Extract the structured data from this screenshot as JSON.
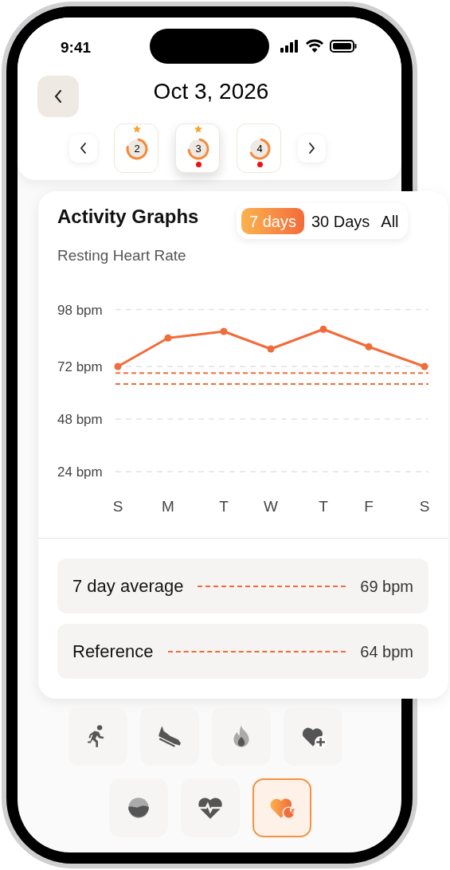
{
  "status_bar": {
    "time": "9:41"
  },
  "header": {
    "title": "Oct 3, 2026"
  },
  "days": [
    {
      "label": "2",
      "starred": true,
      "alert": false,
      "selected": false
    },
    {
      "label": "3",
      "starred": true,
      "alert": true,
      "selected": true
    },
    {
      "label": "4",
      "starred": false,
      "alert": true,
      "selected": false
    }
  ],
  "card": {
    "title": "Activity Graphs",
    "ranges": [
      {
        "label": "7 days",
        "selected": true
      },
      {
        "label": "30 Days",
        "selected": false
      },
      {
        "label": "All",
        "selected": false
      }
    ],
    "subtitle": "Resting Heart Rate",
    "chart_data": {
      "type": "line",
      "categories": [
        "S",
        "M",
        "T",
        "W",
        "T",
        "F",
        "S"
      ],
      "series": [
        {
          "color": "#f26b3a",
          "marker": "o",
          "values": [
            72,
            85,
            88,
            80,
            89,
            81,
            72
          ]
        }
      ],
      "ylim": [
        24,
        98
      ],
      "yticks": [
        {
          "value": 24,
          "label": "24 bpm"
        },
        {
          "value": 48,
          "label": "48 bpm"
        },
        {
          "value": 72,
          "label": "72 bpm"
        },
        {
          "value": 98,
          "label": "98 bpm"
        }
      ],
      "ref_lines": [
        {
          "axis": "y",
          "value": 69
        },
        {
          "axis": "y",
          "value": 64
        }
      ]
    },
    "legend": [
      {
        "label": "7 day average",
        "value": "69 bpm"
      },
      {
        "label": "Reference",
        "value": "64 bpm"
      }
    ]
  },
  "metrics": [
    [
      {
        "kind": "run",
        "selected": false
      },
      {
        "kind": "shoe",
        "selected": false
      },
      {
        "kind": "flame",
        "selected": false
      },
      {
        "kind": "heart-plus",
        "selected": false
      }
    ],
    [
      {
        "kind": "water",
        "selected": false
      },
      {
        "kind": "pulse",
        "selected": false
      },
      {
        "kind": "sleep-heart",
        "selected": true
      }
    ]
  ]
}
